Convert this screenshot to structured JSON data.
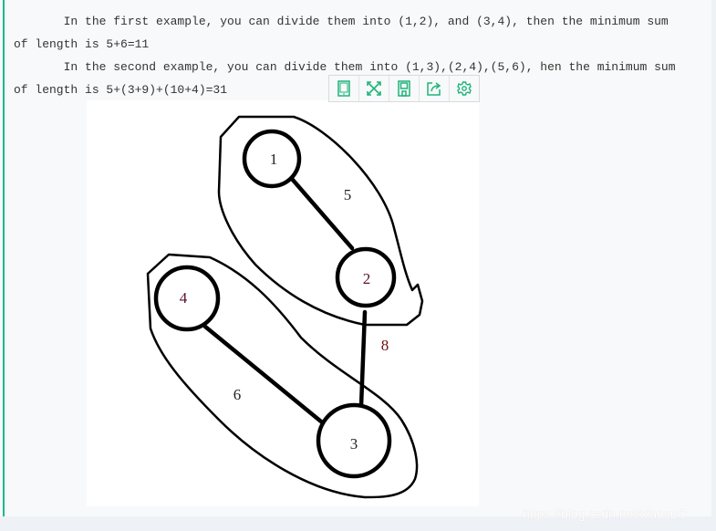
{
  "article": {
    "lines": [
      "       In the first example, you can divide them into (1,2), and (3,4), then the minimum sum",
      "of length is 5+6=11",
      "       In the second example, you can divide them into (1,3),(2,4),(5,6), hen the minimum sum",
      "of length is 5+(3+9)+(10+4)=31"
    ]
  },
  "toolbar": {
    "icons": [
      "tablet-icon",
      "fullscreen-icon",
      "save-icon",
      "share-icon",
      "settings-icon"
    ],
    "accent": "#1fb47a"
  },
  "diagram": {
    "nodes": [
      "1",
      "2",
      "3",
      "4"
    ],
    "edges": [
      "5",
      "8",
      "6"
    ]
  },
  "watermark": "https://blog.csdn.net/xiaosuC",
  "colors": {
    "accent_bar": "#1fb48f",
    "background": "#f8f9fa"
  }
}
